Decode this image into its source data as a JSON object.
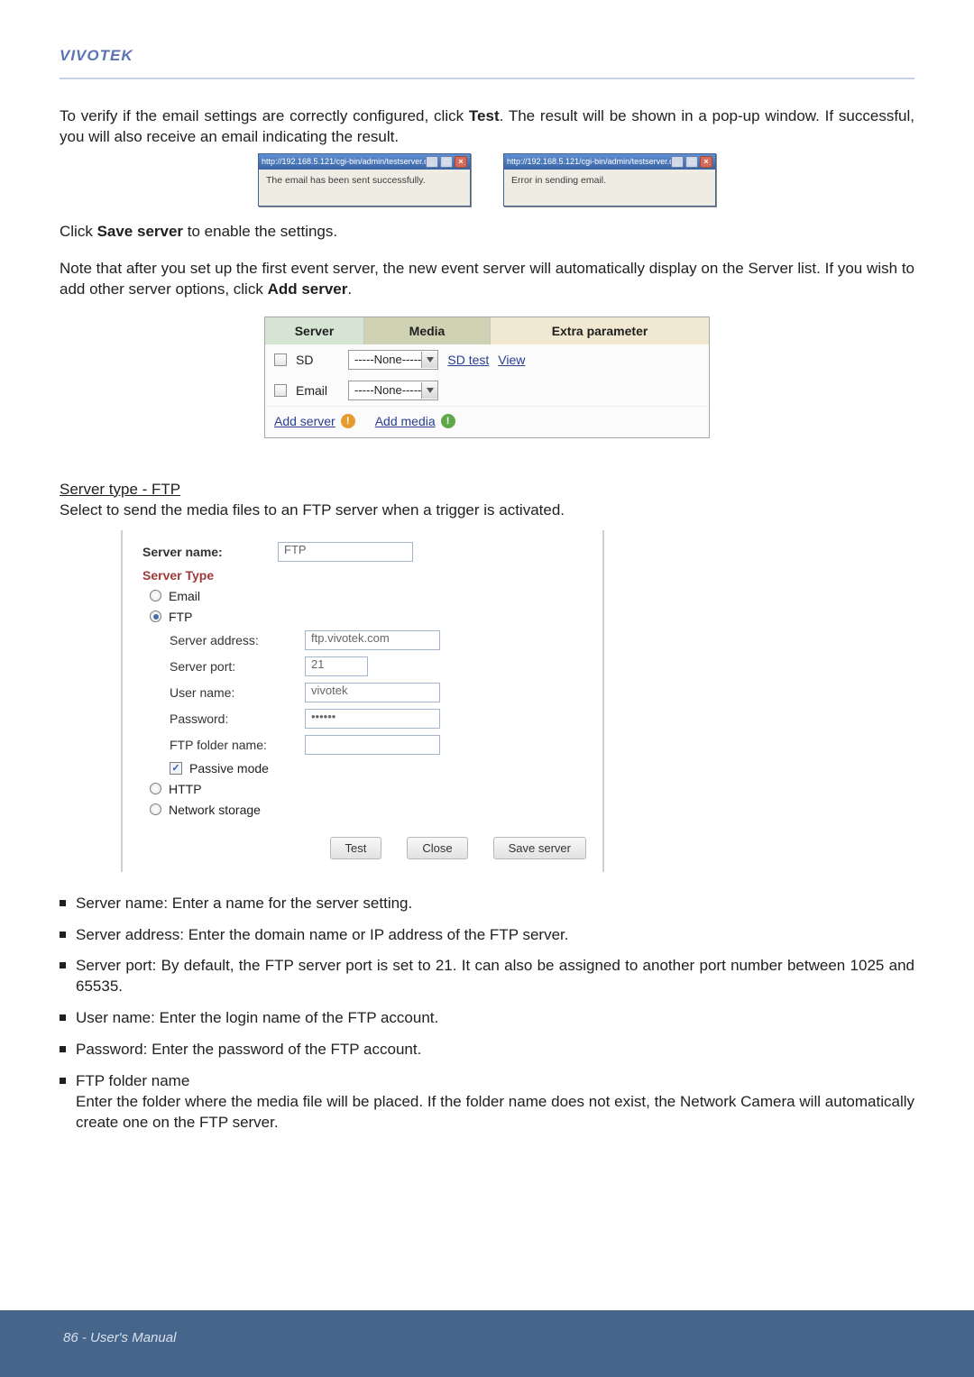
{
  "brand": "VIVOTEK",
  "intro_p1_a": "To verify if the email settings are correctly configured, click ",
  "intro_p1_test": "Test",
  "intro_p1_b": ". The result will be shown in a pop-up window. If successful, you will also receive an email indicating the result.",
  "popup_success": {
    "title": "http://192.168.5.121/cgi-bin/admin/testserver.cgi - ...",
    "body": "The email has been sent successfully."
  },
  "popup_error": {
    "title": "http://192.168.5.121/cgi-bin/admin/testserver.cgi - ...",
    "body": "Error in sending email."
  },
  "click_save_a": "Click ",
  "click_save_b": "Save server",
  "click_save_c": " to enable the settings.",
  "note_a": "Note that after you set up the first event server, the new event server will automatically display on the Server list.  If you wish to add other server options, click ",
  "note_b": "Add server",
  "note_c": ".",
  "server_table": {
    "h_server": "Server",
    "h_media": "Media",
    "h_extra": "Extra parameter",
    "row_sd_label": "SD",
    "row_sd_select": "-----None-----",
    "row_sd_sdtest": "SD test",
    "row_sd_view": "View",
    "row_email_label": "Email",
    "row_email_select": "-----None-----",
    "add_server": "Add server",
    "add_media": "Add media"
  },
  "section_heading": "Server type - FTP",
  "section_sub": "Select to send the media files to an FTP server when a trigger is activated.",
  "ftp": {
    "server_name_label": "Server name:",
    "server_name_value": "FTP",
    "server_type_label": "Server Type",
    "opt_email": "Email",
    "opt_ftp": "FTP",
    "server_address_label": "Server address:",
    "server_address_value": "ftp.vivotek.com",
    "server_port_label": "Server port:",
    "server_port_value": "21",
    "user_name_label": "User name:",
    "user_name_value": "vivotek",
    "password_label": "Password:",
    "password_value": "••••••",
    "ftp_folder_label": "FTP folder name:",
    "ftp_folder_value": "",
    "passive_label": "Passive mode",
    "opt_http": "HTTP",
    "opt_ns": "Network storage",
    "btn_test": "Test",
    "btn_close": "Close",
    "btn_save": "Save server"
  },
  "bullets": {
    "b1": "Server name: Enter a name for the server setting.",
    "b2": "Server address: Enter the domain name or IP address of the FTP server.",
    "b3": "Server port: By default, the FTP server port is set to 21. It can also be assigned to another port number between 1025 and 65535.",
    "b4": "User name: Enter the login name of the FTP account.",
    "b5": "Password: Enter the password of the FTP account.",
    "b6_head": "FTP folder name",
    "b6_body": "Enter the folder where the media file will be placed. If the folder name does not exist, the Network Camera will automatically create one on the FTP server."
  },
  "footer": "86 - User's Manual"
}
